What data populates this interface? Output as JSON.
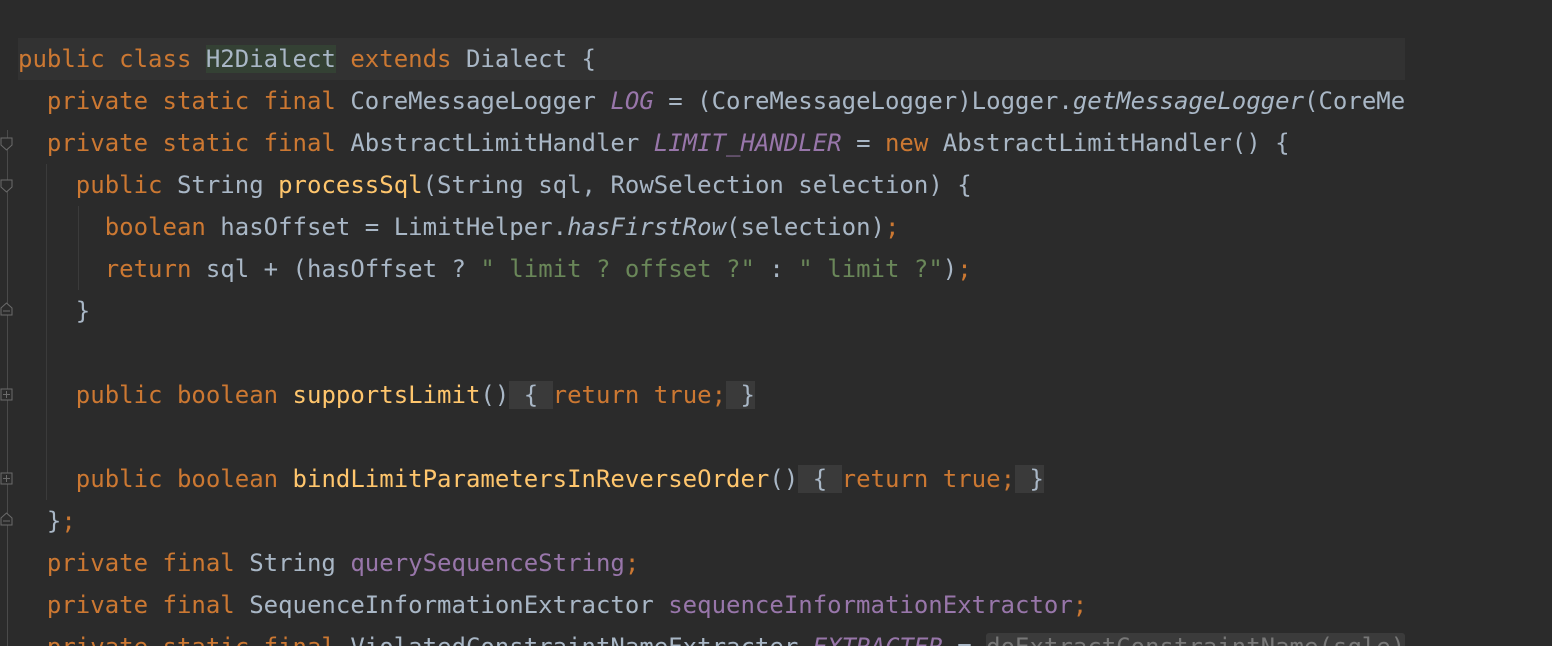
{
  "editor": {
    "language": "java",
    "colors": {
      "background": "#2b2b2b",
      "keyword": "#cc7832",
      "method": "#ffc66d",
      "string": "#6a8759",
      "field": "#9876aa",
      "text": "#a9b7c6"
    },
    "gutter_icons": [
      "fold-start-icon",
      "fold-start-icon",
      "fold-end-icon",
      "fold-expand-icon",
      "fold-expand-icon",
      "fold-end-icon"
    ],
    "lines": {
      "l1": {
        "t1": "public class ",
        "t2": "H2Dialect",
        "t3": " extends ",
        "t4": "Dialect {"
      },
      "l2": {
        "t1": "  private static final ",
        "t2": "CoreMessageLogger ",
        "t3": "LOG",
        "t4": " = (CoreMessageLogger)Logger.",
        "t5": "getMessageLogger",
        "t6": "(CoreMe"
      },
      "l3": {
        "t1": "  private static final ",
        "t2": "AbstractLimitHandler ",
        "t3": "LIMIT_HANDLER",
        "t4": " = ",
        "t5": "new ",
        "t6": "AbstractLimitHandler() {"
      },
      "l4": {
        "t1": "    public ",
        "t2": "String ",
        "t3": "processSql",
        "t4": "(String sql, RowSelection selection) {"
      },
      "l5": {
        "t1": "      boolean ",
        "t2": "hasOffset = LimitHelper.",
        "t3": "hasFirstRow",
        "t4": "(selection)",
        "t5": ";"
      },
      "l6": {
        "t1": "      return ",
        "t2": "sql + (hasOffset ? ",
        "t3": "\" limit ? offset ?\"",
        "t4": " : ",
        "t5": "\" limit ?\"",
        "t6": ")",
        "t7": ";"
      },
      "l7": {
        "t1": "    }"
      },
      "l9": {
        "t1": "    public boolean ",
        "t2": "supportsLimit",
        "t3": "()",
        "t4": " { ",
        "t5": "return true;",
        "t6": " }"
      },
      "l11": {
        "t1": "    public boolean ",
        "t2": "bindLimitParametersInReverseOrder",
        "t3": "()",
        "t4": " { ",
        "t5": "return true;",
        "t6": " }"
      },
      "l12": {
        "t1": "  }",
        "t2": ";"
      },
      "l13": {
        "t1": "  private final ",
        "t2": "String ",
        "t3": "querySequenceString",
        "t4": ";"
      },
      "l14": {
        "t1": "  private final ",
        "t2": "SequenceInformationExtractor ",
        "t3": "sequenceInformationExtractor",
        "t4": ";"
      },
      "l15": {
        "t1": "  private static final ",
        "t2": "ViolatedConstraintNameExtracter ",
        "t3": "EXTRACTER",
        "t4": " = ",
        "t5": "doExtractConstraintName(sqle)"
      }
    }
  }
}
